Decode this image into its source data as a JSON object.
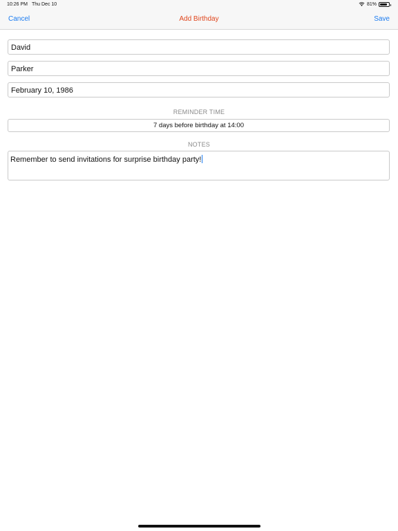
{
  "status_bar": {
    "time": "10:26 PM",
    "date": "Thu Dec 10",
    "battery": "81%",
    "battery_level": 0.81
  },
  "nav": {
    "cancel_label": "Cancel",
    "title": "Add Birthday",
    "save_label": "Save"
  },
  "form": {
    "first_name": "David",
    "last_name": "Parker",
    "birthday": "February 10, 1986",
    "reminder_label": "REMINDER TIME",
    "reminder_value": "7 days before birthday at 14:00",
    "notes_label": "NOTES",
    "notes_value": "Remember to send invitations for surprise birthday party!"
  },
  "colors": {
    "accent": "#1a7bf0",
    "title": "#e0461d"
  }
}
